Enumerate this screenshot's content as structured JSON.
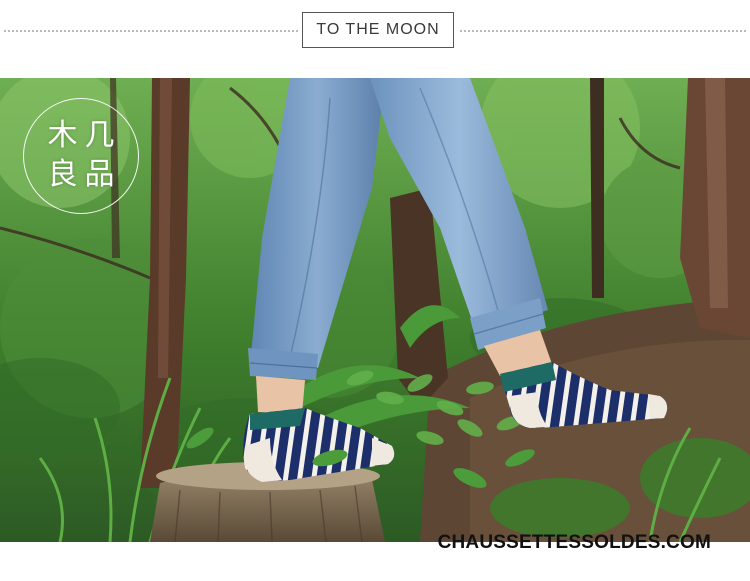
{
  "header": {
    "title": "TO THE MOON"
  },
  "logo": {
    "chars": [
      "木",
      "几",
      "良",
      "品"
    ]
  },
  "watermark": {
    "text": "CHAUSSETTESSOLDES.COM"
  },
  "colors": {
    "sock_green": "#1e6a64",
    "sock_navy": "#1d2f6b",
    "denim": "#6f94bd",
    "foliage": "#3f8a34"
  }
}
